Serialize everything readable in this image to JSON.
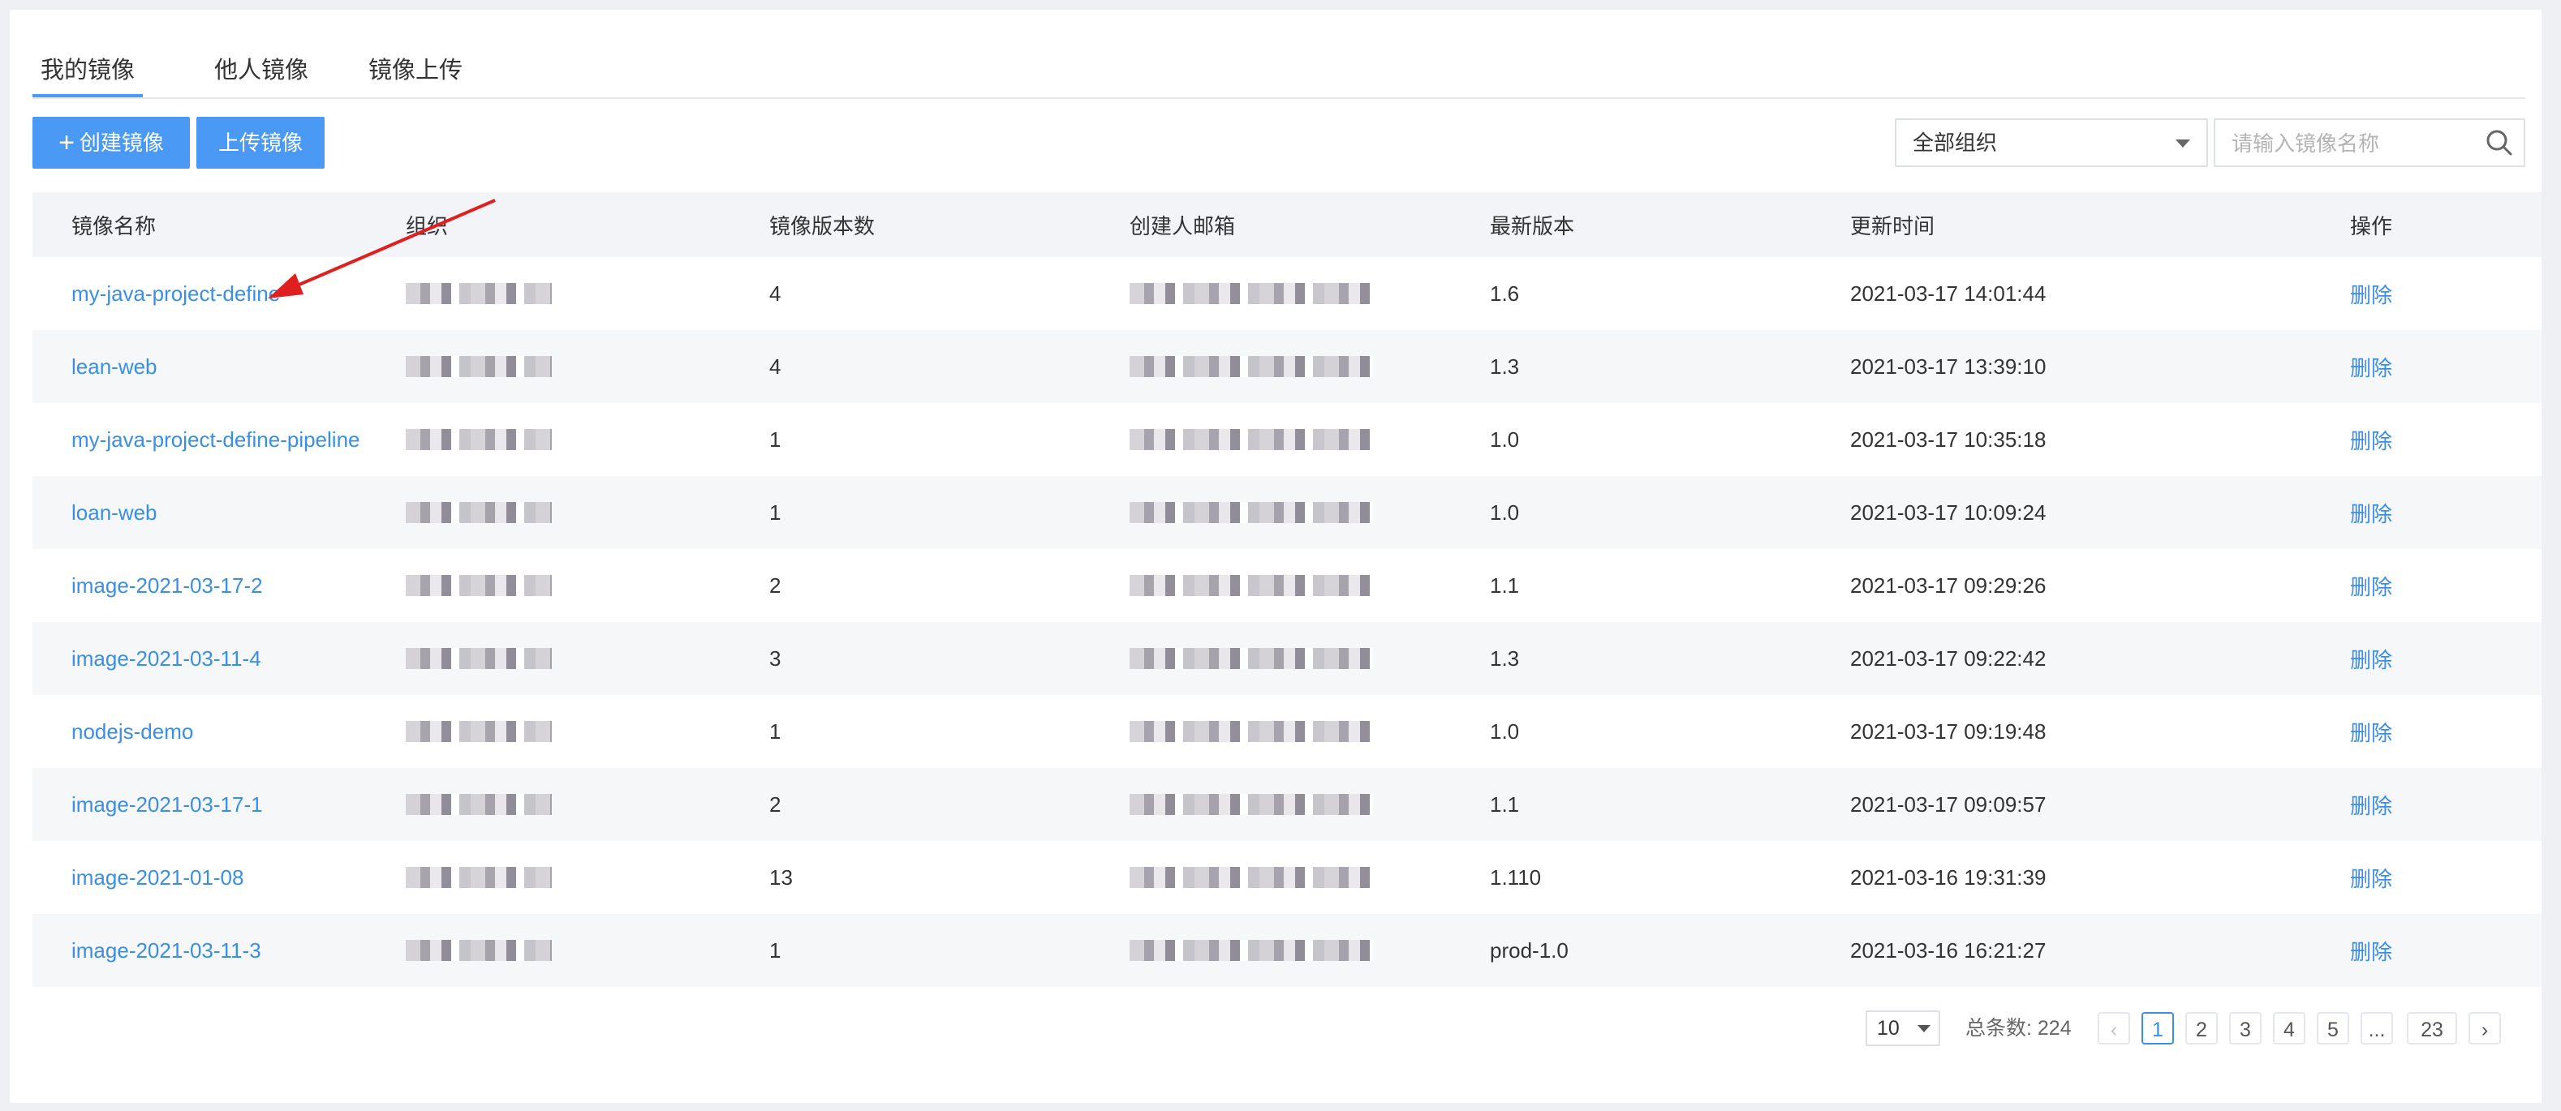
{
  "tabs": [
    {
      "label": "我的镜像",
      "active": true
    },
    {
      "label": "他人镜像",
      "active": false
    },
    {
      "label": "镜像上传",
      "active": false
    }
  ],
  "toolbar": {
    "create_label": "创建镜像",
    "upload_label": "上传镜像",
    "org_select_value": "全部组织",
    "search_placeholder": "请输入镜像名称"
  },
  "table": {
    "headers": [
      "镜像名称",
      "组织",
      "镜像版本数",
      "创建人邮箱",
      "最新版本",
      "更新时间",
      "操作"
    ],
    "rows": [
      {
        "name": "my-java-project-define",
        "versions": "4",
        "latest": "1.6",
        "updated": "2021-03-17 14:01:44",
        "action": "删除"
      },
      {
        "name": "lean-web",
        "versions": "4",
        "latest": "1.3",
        "updated": "2021-03-17 13:39:10",
        "action": "删除"
      },
      {
        "name": "my-java-project-define-pipeline",
        "versions": "1",
        "latest": "1.0",
        "updated": "2021-03-17 10:35:18",
        "action": "删除"
      },
      {
        "name": "loan-web",
        "versions": "1",
        "latest": "1.0",
        "updated": "2021-03-17 10:09:24",
        "action": "删除"
      },
      {
        "name": "image-2021-03-17-2",
        "versions": "2",
        "latest": "1.1",
        "updated": "2021-03-17 09:29:26",
        "action": "删除"
      },
      {
        "name": "image-2021-03-11-4",
        "versions": "3",
        "latest": "1.3",
        "updated": "2021-03-17 09:22:42",
        "action": "删除"
      },
      {
        "name": "nodejs-demo",
        "versions": "1",
        "latest": "1.0",
        "updated": "2021-03-17 09:19:48",
        "action": "删除"
      },
      {
        "name": "image-2021-03-17-1",
        "versions": "2",
        "latest": "1.1",
        "updated": "2021-03-17 09:09:57",
        "action": "删除"
      },
      {
        "name": "image-2021-01-08",
        "versions": "13",
        "latest": "1.110",
        "updated": "2021-03-16 19:31:39",
        "action": "删除"
      },
      {
        "name": "image-2021-03-11-3",
        "versions": "1",
        "latest": "prod-1.0",
        "updated": "2021-03-16 16:21:27",
        "action": "删除"
      }
    ]
  },
  "pagination": {
    "page_size": "10",
    "total_label": "总条数: 224",
    "pages": [
      "1",
      "2",
      "3",
      "4",
      "5",
      "...",
      "23"
    ],
    "current": "1",
    "prev": "‹",
    "next": "›"
  },
  "colors": {
    "accent": "#4a9af5",
    "link": "#3a8ee6",
    "annotation_arrow": "#e02020"
  },
  "icons": {
    "search": "search-icon",
    "dropdown": "chevron-down-icon"
  }
}
